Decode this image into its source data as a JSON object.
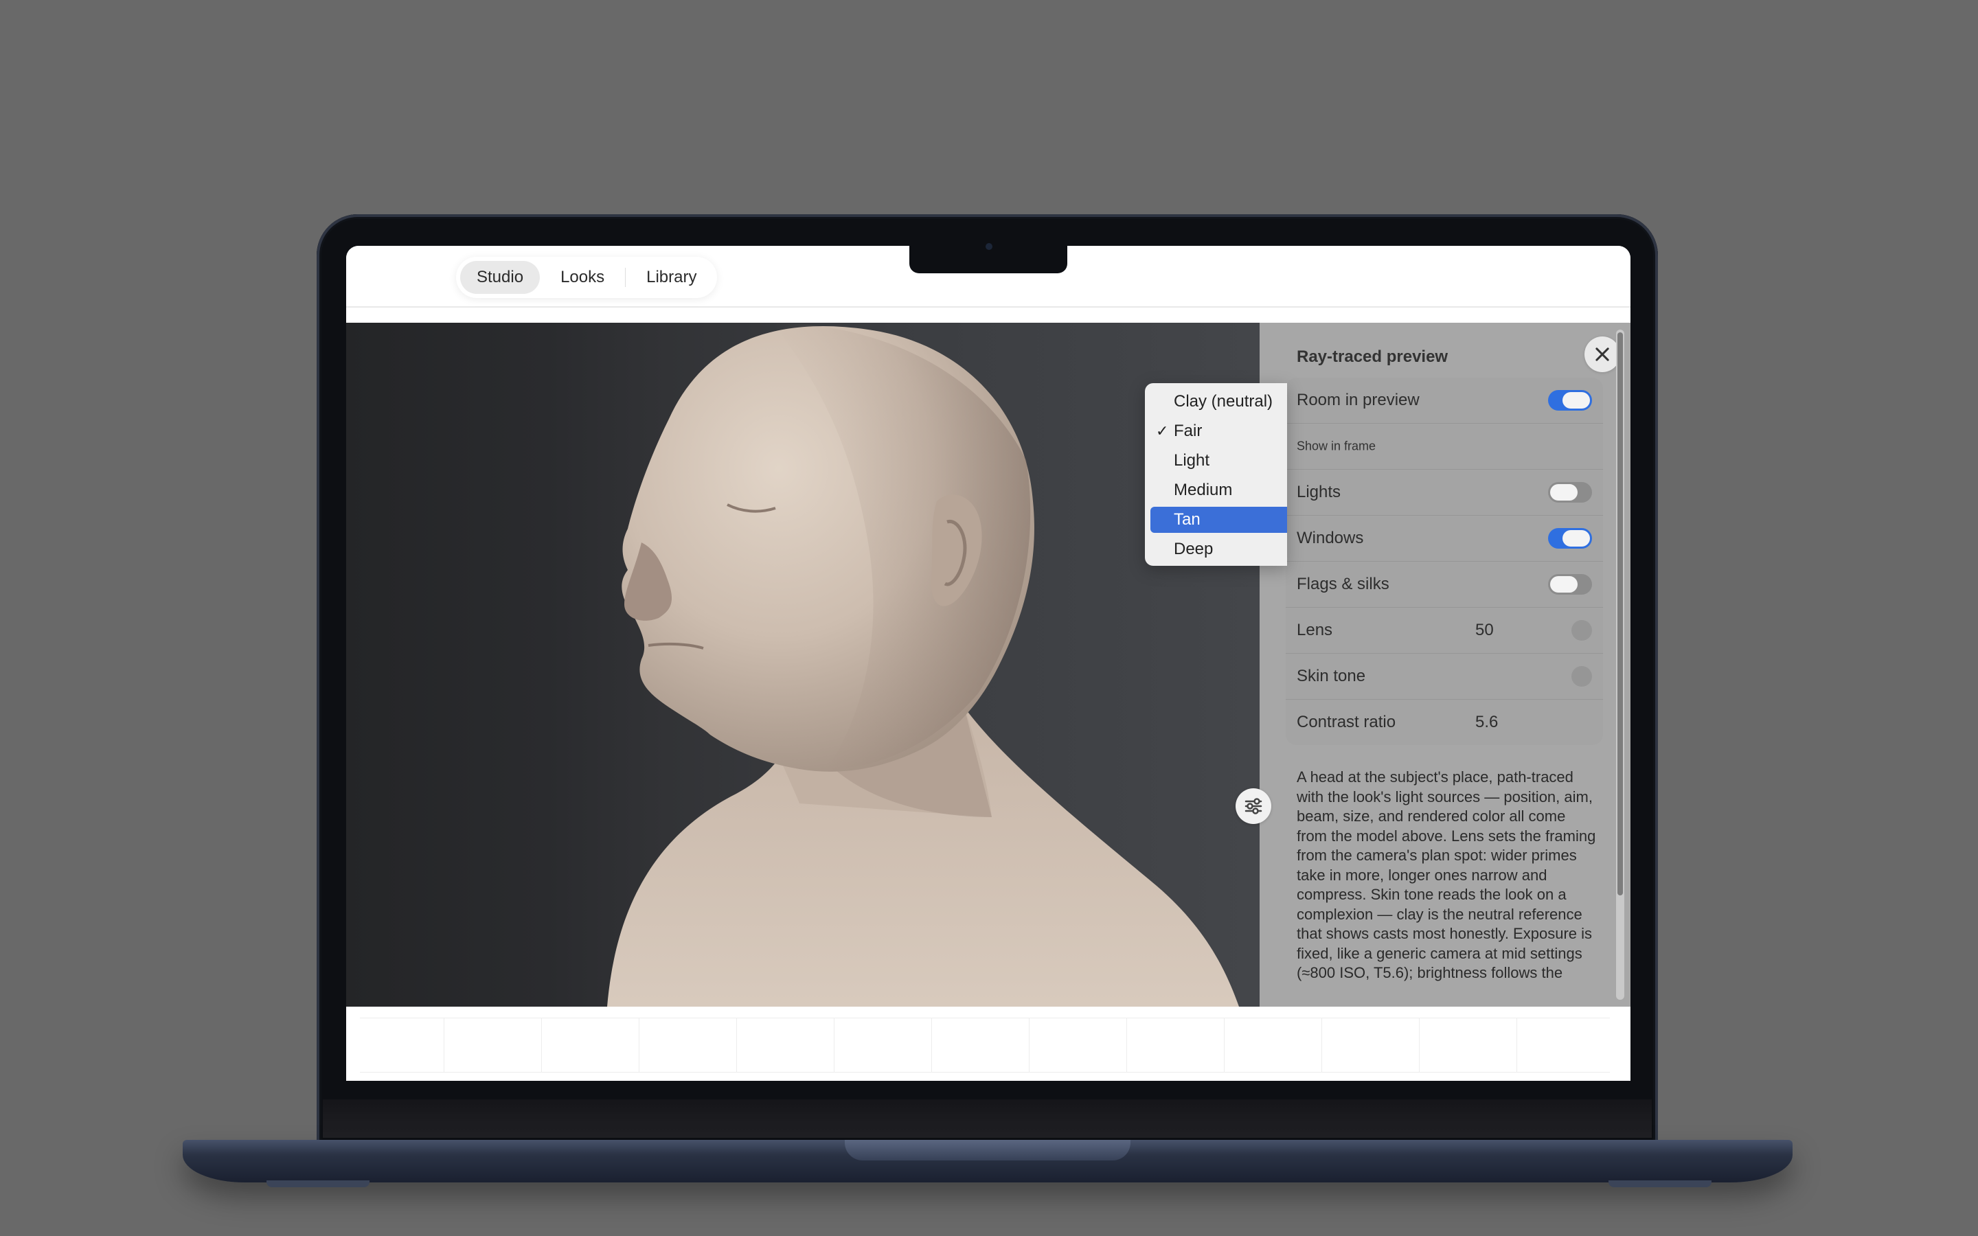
{
  "tabs": [
    {
      "label": "Studio",
      "active": true
    },
    {
      "label": "Looks",
      "active": false
    },
    {
      "label": "Library",
      "active": false
    }
  ],
  "panel": {
    "title": "Ray-traced preview",
    "rows": {
      "room_in_preview": {
        "label": "Room in preview",
        "on": true
      },
      "show_in_frame": {
        "label": "Show in frame"
      },
      "lights": {
        "label": "Lights",
        "on": false
      },
      "windows": {
        "label": "Windows",
        "on": true
      },
      "flags_silks": {
        "label": "Flags & silks",
        "on": false
      },
      "lens": {
        "label": "Lens",
        "value": "50"
      },
      "skin_tone": {
        "label": "Skin tone"
      },
      "contrast_ratio": {
        "label": "Contrast ratio",
        "value": "5.6"
      }
    },
    "description": "A head at the subject's place, path-traced with the look's light sources — position, aim, beam, size, and rendered color all come from the model above. Lens sets the framing from the camera's plan spot: wider primes take in more, longer ones narrow and compress. Skin tone reads the look on a complexion — clay is the neutral reference that shows casts most honestly. Exposure is fixed, like a generic camera at mid settings (≈800 ISO, T5.6); brightness follows the"
  },
  "skin_tone_menu": {
    "options": [
      "Clay (neutral)",
      "Fair",
      "Light",
      "Medium",
      "Tan",
      "Deep"
    ],
    "checked": "Fair",
    "highlighted": "Tan",
    "check_glyph": "✓"
  },
  "colors": {
    "accent": "#2f6fe0",
    "menu_highlight": "#3b6fd8",
    "panel_bg": "#a7a7a7",
    "skin": "#cdbdaf",
    "desktop_bg": "#696969"
  },
  "icons": {
    "close": "close-icon",
    "settings": "sliders-icon"
  }
}
